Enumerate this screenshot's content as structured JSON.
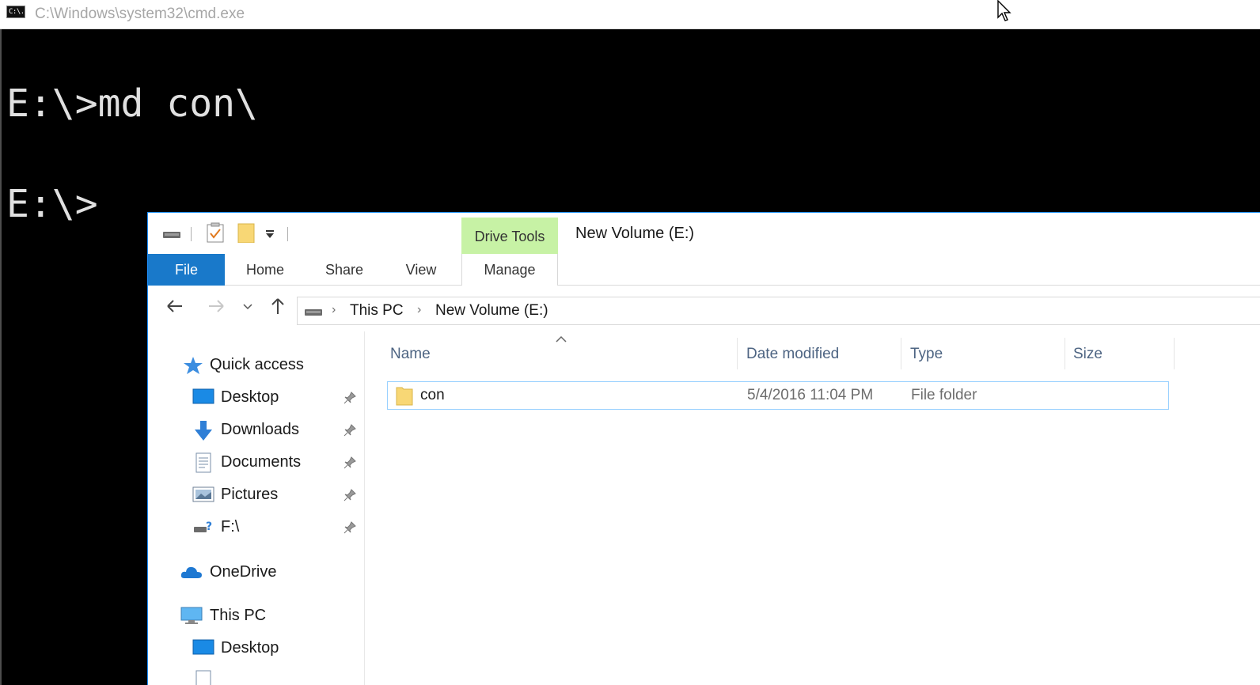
{
  "cmd": {
    "title": "C:\\Windows\\system32\\cmd.exe",
    "icon_text": "C:\\.",
    "lines": [
      "E:\\>md con\\",
      "E:\\>"
    ]
  },
  "explorer": {
    "window_title": "New Volume (E:)",
    "context_tab_group": "Drive Tools",
    "ribbon_tabs": {
      "file": "File",
      "home": "Home",
      "share": "Share",
      "view": "View",
      "manage": "Manage"
    },
    "address": {
      "crumbs": [
        "This PC",
        "New Volume (E:)"
      ]
    },
    "nav_pane": {
      "quick_access": "Quick access",
      "items": [
        {
          "label": "Desktop",
          "icon": "desktop-icon",
          "pinned": true
        },
        {
          "label": "Downloads",
          "icon": "downloads-icon",
          "pinned": true
        },
        {
          "label": "Documents",
          "icon": "documents-icon",
          "pinned": true
        },
        {
          "label": "Pictures",
          "icon": "pictures-icon",
          "pinned": true
        },
        {
          "label": "F:\\",
          "icon": "network-drive-icon",
          "pinned": true
        }
      ],
      "onedrive": "OneDrive",
      "this_pc": "This PC",
      "this_pc_items": [
        {
          "label": "Desktop",
          "icon": "desktop-icon"
        }
      ]
    },
    "columns": {
      "name": "Name",
      "date_modified": "Date modified",
      "type": "Type",
      "size": "Size"
    },
    "files": [
      {
        "name": "con",
        "date_modified": "5/4/2016 11:04 PM",
        "type": "File folder",
        "size": ""
      }
    ]
  },
  "colors": {
    "accent": "#1979ca",
    "context_tab": "#c7f2a5",
    "selection_border": "#99d1ff",
    "console_bg": "#000000",
    "console_fg": "#e0e0e0"
  }
}
